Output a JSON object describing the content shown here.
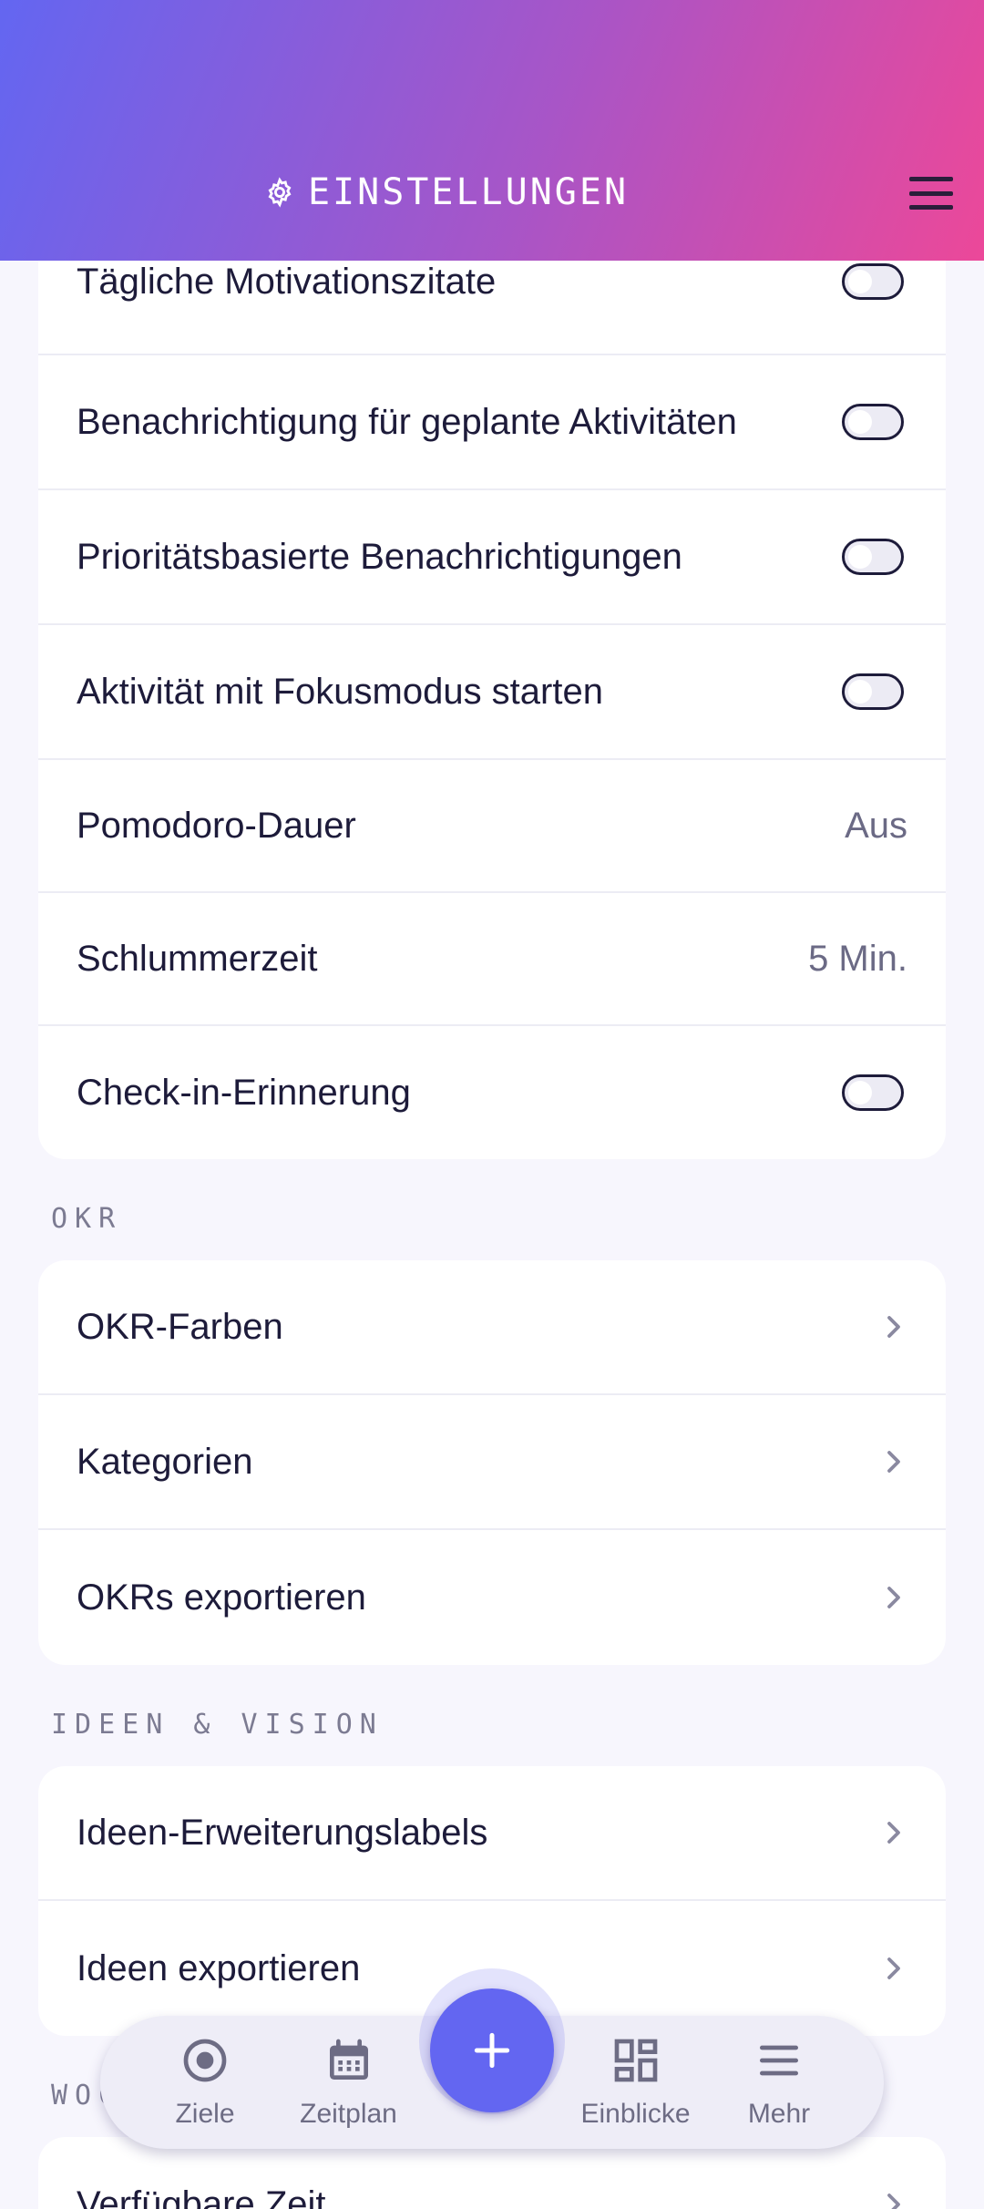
{
  "header": {
    "title": "EINSTELLUNGEN",
    "gradient": [
      "#6366f1",
      "#ec4899"
    ]
  },
  "sections": {
    "notifications": {
      "rows": [
        {
          "label": "Tägliche Motivationszitate",
          "control": "toggle",
          "on": false
        },
        {
          "label": "Benachrichtigung für geplante Aktivitäten",
          "control": "toggle",
          "on": false
        },
        {
          "label": "Prioritätsbasierte Benachrichtigungen",
          "control": "toggle",
          "on": false
        },
        {
          "label": "Aktivität mit Fokusmodus starten",
          "control": "toggle",
          "on": false
        },
        {
          "label": "Pomodoro-Dauer",
          "control": "value",
          "value": "Aus"
        },
        {
          "label": "Schlummerzeit",
          "control": "value",
          "value": "5 Min."
        },
        {
          "label": "Check-in-Erinnerung",
          "control": "toggle",
          "on": false
        }
      ]
    },
    "okr": {
      "title": "OKR",
      "rows": [
        {
          "label": "OKR-Farben"
        },
        {
          "label": "Kategorien"
        },
        {
          "label": "OKRs exportieren"
        }
      ]
    },
    "ideas": {
      "title": "IDEEN & VISION",
      "rows": [
        {
          "label": "Ideen-Erweiterungslabels"
        },
        {
          "label": "Ideen exportieren"
        }
      ]
    },
    "woc": {
      "title": "WOC",
      "rows": [
        {
          "label": "Verfügbare Zeit"
        }
      ]
    }
  },
  "bottom_nav": {
    "items": [
      {
        "label": "Ziele",
        "icon": "target-icon"
      },
      {
        "label": "Zeitplan",
        "icon": "calendar-icon"
      },
      {
        "label": "Einblicke",
        "icon": "dashboard-icon"
      },
      {
        "label": "Mehr",
        "icon": "menu-icon"
      }
    ],
    "fab_icon": "plus-icon",
    "accent": "#6366f1"
  }
}
